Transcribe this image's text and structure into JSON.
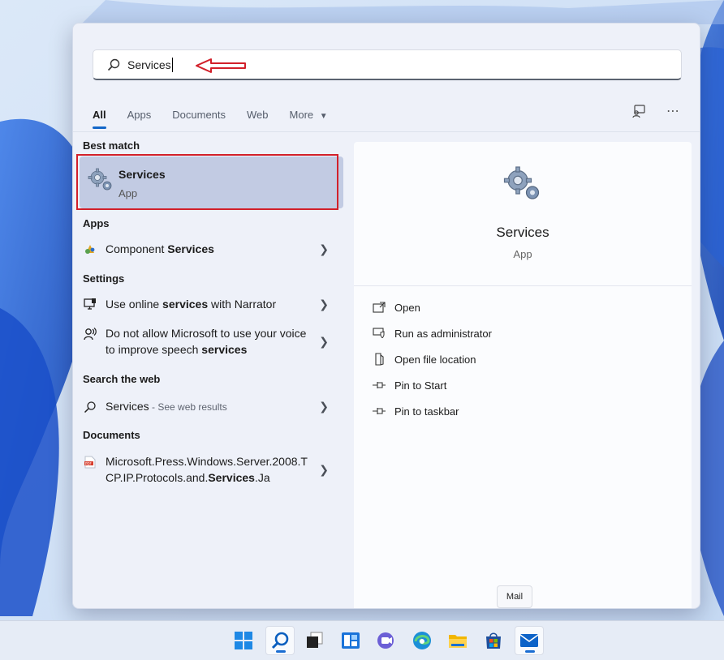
{
  "search": {
    "query": "Services"
  },
  "tabs": [
    {
      "label": "All"
    },
    {
      "label": "Apps"
    },
    {
      "label": "Documents"
    },
    {
      "label": "Web"
    },
    {
      "label": "More"
    }
  ],
  "sections": {
    "best_match": "Best match",
    "apps": "Apps",
    "settings": "Settings",
    "search_web": "Search the web",
    "documents": "Documents"
  },
  "best_match": {
    "name": "Services",
    "kind": "App"
  },
  "apps": [
    {
      "pre": "Component ",
      "bold": "Services",
      "post": ""
    }
  ],
  "settings": [
    {
      "pre": "Use online ",
      "bold": "services",
      "post": " with Narrator"
    },
    {
      "pre": "Do not allow Microsoft to use your voice to improve speech ",
      "bold": "services",
      "post": ""
    }
  ],
  "web": {
    "term": "Services",
    "suffix": " - See web results"
  },
  "documents": [
    {
      "pre": "Microsoft.Press.Windows.Server.2008.TCP.IP.Protocols.and.",
      "bold": "Services",
      "post": ".Ja"
    }
  ],
  "preview": {
    "title": "Services",
    "kind": "App",
    "actions": [
      {
        "label": "Open",
        "icon": "open-icon"
      },
      {
        "label": "Run as administrator",
        "icon": "shield-icon"
      },
      {
        "label": "Open file location",
        "icon": "folder-icon"
      },
      {
        "label": "Pin to Start",
        "icon": "pin-icon"
      },
      {
        "label": "Pin to taskbar",
        "icon": "pin-icon"
      }
    ]
  },
  "tooltip": "Mail",
  "taskbar": {
    "items": [
      "start-icon",
      "search-icon",
      "task-view-icon",
      "widgets-icon",
      "teams-chat-icon",
      "edge-icon",
      "file-explorer-icon",
      "store-icon",
      "mail-icon"
    ]
  },
  "colors": {
    "accent": "#1266c8",
    "highlight": "#c2cbe3",
    "annotation": "#d2202a"
  }
}
